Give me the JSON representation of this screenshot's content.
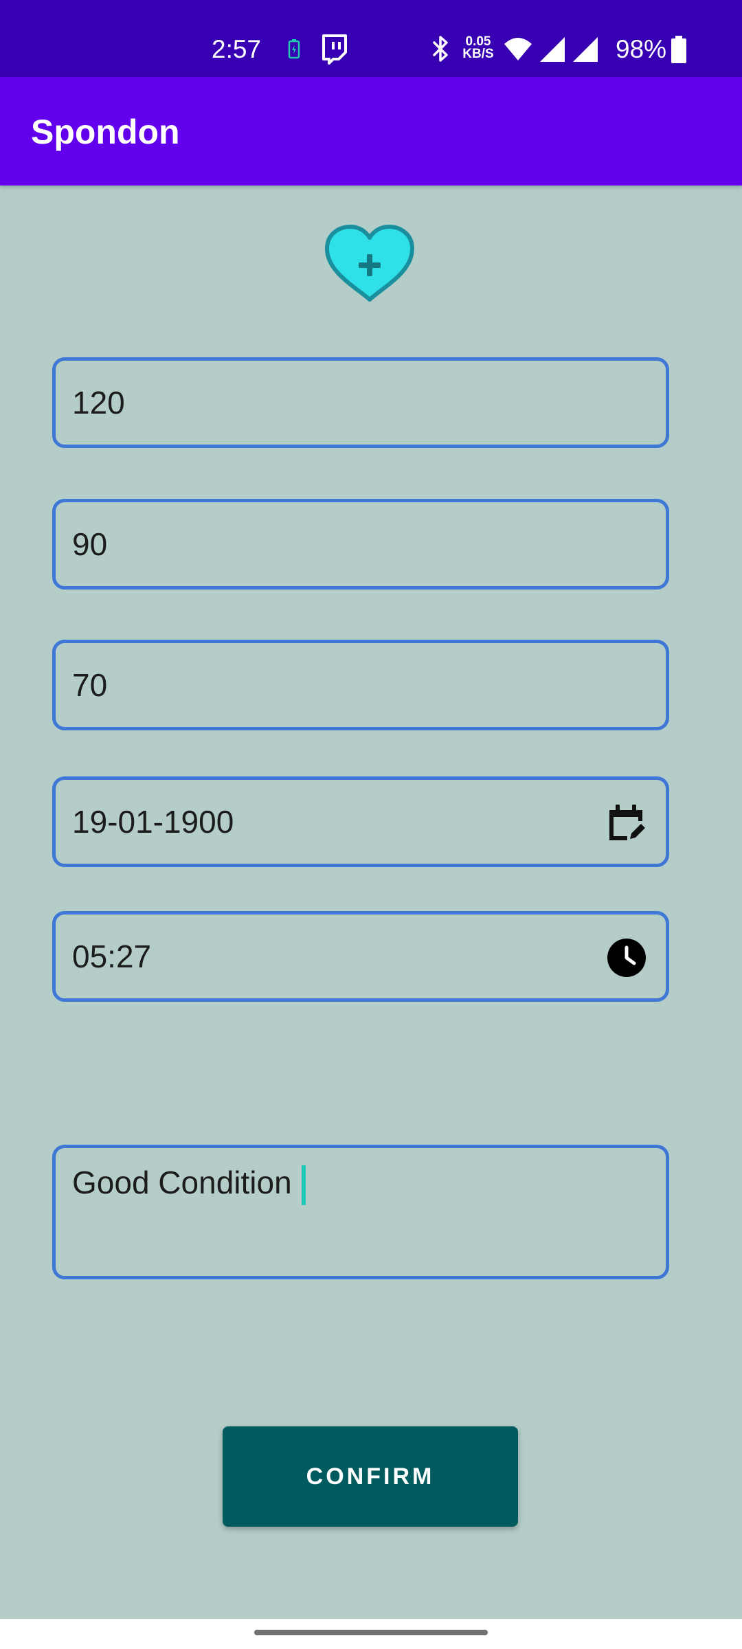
{
  "status_bar": {
    "time": "2:57",
    "net_speed_value": "0.05",
    "net_speed_unit": "KB/S",
    "battery_percent": "98%",
    "icons": [
      "battery-saver-icon",
      "twitch-icon",
      "bluetooth-icon",
      "wifi-icon",
      "cell-signal-icon",
      "cell-signal-icon",
      "battery-icon"
    ]
  },
  "app_bar": {
    "title": "Spondon"
  },
  "logo": {
    "icon": "heart-plus-icon",
    "color": "#2fe0e8"
  },
  "form": {
    "systolic": "120",
    "diastolic": "90",
    "pulse": "70",
    "date": "19-01-1900",
    "date_icon": "calendar-edit-icon",
    "time": "05:27",
    "time_icon": "clock-icon",
    "notes": "Good Condition"
  },
  "confirm_button": {
    "label": "CONFIRM"
  },
  "colors": {
    "status_bar": "#3700b3",
    "app_bar": "#6200ee",
    "background": "#b4cdc9",
    "field_border": "#3f77d6",
    "button": "#005b5e",
    "cursor": "#1fc9b8"
  }
}
